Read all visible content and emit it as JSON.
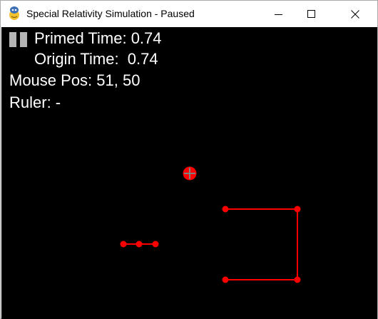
{
  "window": {
    "title": "Special Relativity Simulation - Paused"
  },
  "hud": {
    "primed_time": "Primed Time: 0.74",
    "origin_time": "Origin Time:  0.74",
    "mouse_pos": "Mouse Pos: 51, 50",
    "ruler": "Ruler: -"
  },
  "colors": {
    "background": "#000000",
    "hud_text": "#ffffff",
    "objects": "#ff0000",
    "pause_icon": "#b5b5b5",
    "crosshair": "#808080"
  },
  "icons": {
    "app": "pygame-snake-icon",
    "pause": "pause-icon"
  }
}
